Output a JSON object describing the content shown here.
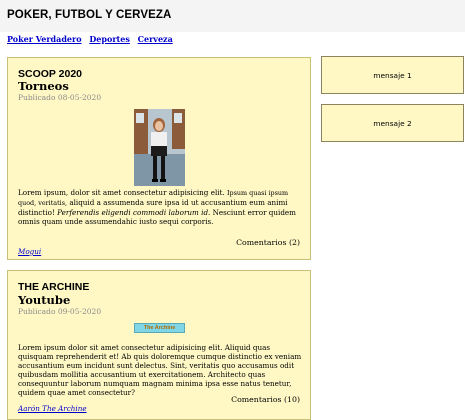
{
  "site": {
    "title": "POKER, FUTBOL Y CERVEZA"
  },
  "nav": {
    "items": [
      "Poker Verdadero",
      "Deportes",
      "Cerveza"
    ]
  },
  "posts": [
    {
      "category": "SCOOP 2020",
      "title": "Torneos",
      "date": "Publicado 08-05-2020",
      "body_part1": "Lorem ipsum, dolor sit amet consectetur adipisicing elit.",
      "body_small": "Ipsum quasi ipsum quod, veritatis,",
      "body_part2": "aliquid a assumenda sure ipsa id ut accusantium eum animi distinctio!",
      "body_emph": "Perferendis eligendi commodi laborum id.",
      "body_part3": "Nesciunt error quidem omnis quam unde assumendahic iusto sequi corporis.",
      "comments": "Comentarios (2)",
      "author": "Mogui"
    },
    {
      "category": "THE ARCHINE",
      "title": "Youtube",
      "date": "Publicado 09-05-2020",
      "banner_text": "The Archine",
      "body": "Lorem ipsum dolor sit amet consectetur adipisicing elit. Aliquid quas quisquam reprehenderit et! Ab quis doloremque cumque distinctio ex veniam accusantium eum incidunt sunt delectus. Sint, veritatis quo accusamus odit quibusdam mollitia accusantium ut exercitationem. Architecto quas consequuntur laborum numquam magnam minima ipsa esse natus tenetur, quidem quae amet consectetur?",
      "comments": "Comentarios (10)",
      "author": "Aarón The Archine"
    }
  ],
  "sidebar": {
    "messages": [
      "mensaje 1",
      "mensaje 2"
    ]
  },
  "colors": {
    "card_background": "#fff8c5",
    "link": "#0000cc",
    "header_background": "#f4f4f4"
  }
}
